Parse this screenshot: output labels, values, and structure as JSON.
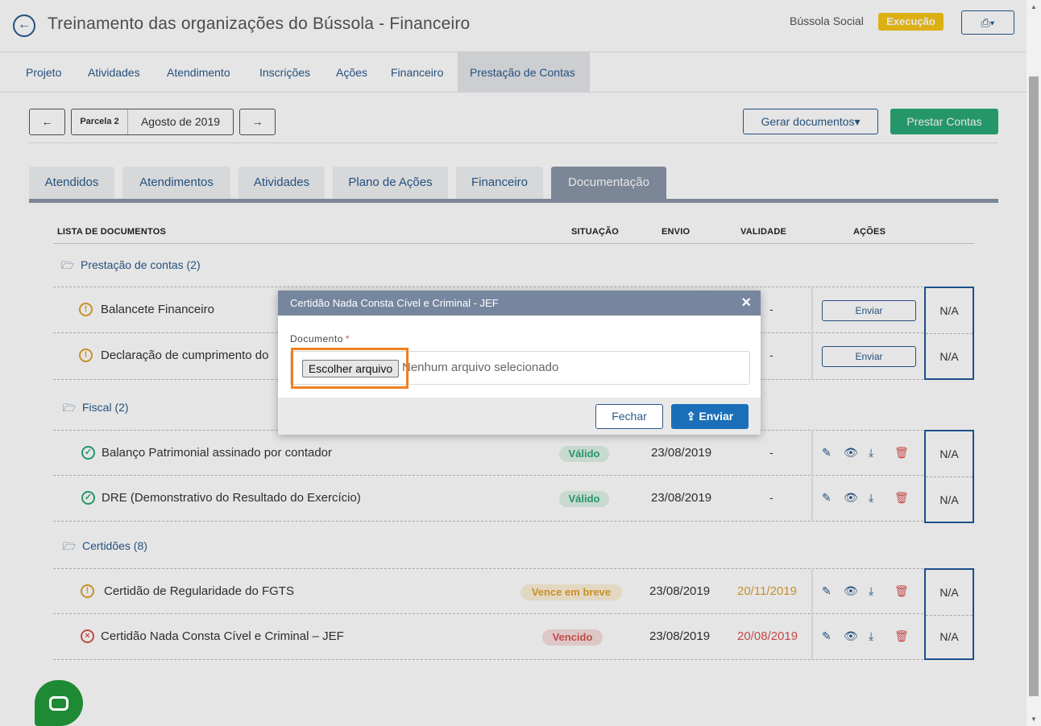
{
  "header": {
    "title": "Treinamento das organizações do Bússola - Financeiro",
    "org_name": "Bússola Social",
    "status": "Execução"
  },
  "nav": {
    "items": [
      "Projeto",
      "Atividades",
      "Atendimento",
      "Inscrições",
      "Ações",
      "Financeiro",
      "Prestação de Contas"
    ],
    "active": "Prestação de Contas"
  },
  "toolbar": {
    "prev": "←",
    "next": "→",
    "parcel_tag": "Parcela 2",
    "parcel_month": "Agosto de 2019",
    "gen_docs": "Gerar documentos▾",
    "prestar": "Prestar Contas"
  },
  "subtabs": [
    "Atendidos",
    "Atendimentos",
    "Atividades",
    "Plano de Ações",
    "Financeiro",
    "Documentação"
  ],
  "table": {
    "headers": {
      "list": "LISTA DE DOCUMENTOS",
      "situacao": "SITUAÇÃO",
      "envio": "ENVIO",
      "validade": "VALIDADE",
      "acoes": "AÇÕES"
    },
    "groups": [
      {
        "title": "Prestação de contas (2)",
        "rows": [
          {
            "name": "Balancete Financeiro",
            "status": "",
            "envio": "",
            "validade": "-",
            "action": "Enviar",
            "na": "N/A"
          },
          {
            "name": "Declaração de cumprimento do",
            "status": "",
            "envio": "",
            "validade": "-",
            "action": "Enviar",
            "na": "N/A"
          }
        ]
      },
      {
        "title": "Fiscal (2)",
        "rows": [
          {
            "name": "Balanço Patrimonial assinado por contador",
            "status": "Válido",
            "envio": "23/08/2019",
            "validade": "-",
            "na": "N/A"
          },
          {
            "name": "DRE (Demonstrativo do Resultado do Exercício)",
            "status": "Válido",
            "envio": "23/08/2019",
            "validade": "-",
            "na": "N/A"
          }
        ]
      },
      {
        "title": "Certidões (8)",
        "rows": [
          {
            "name": "Certidão de Regularidade do FGTS",
            "status": "Vence em breve",
            "envio": "23/08/2019",
            "validade": "20/11/2019",
            "na": "N/A"
          },
          {
            "name": "Certidão Nada Consta Cível e Criminal – JEF",
            "status": "Vencido",
            "envio": "23/08/2019",
            "validade": "20/08/2019",
            "na": "N/A"
          }
        ]
      }
    ]
  },
  "modal": {
    "title": "Certidão Nada Consta Cível e Criminal - JEF",
    "close": "×",
    "field_label": "Documento",
    "required_mark": "*",
    "file_button": "Escolher arquivo",
    "file_status": "Nenhum arquivo selecionado",
    "btn_close": "Fechar",
    "btn_send": "Enviar"
  },
  "colors": {
    "primary": "#2a5a8c",
    "success": "#2aa876",
    "warning": "#e0a030",
    "danger": "#d9534f",
    "highlight": "#f08020"
  }
}
